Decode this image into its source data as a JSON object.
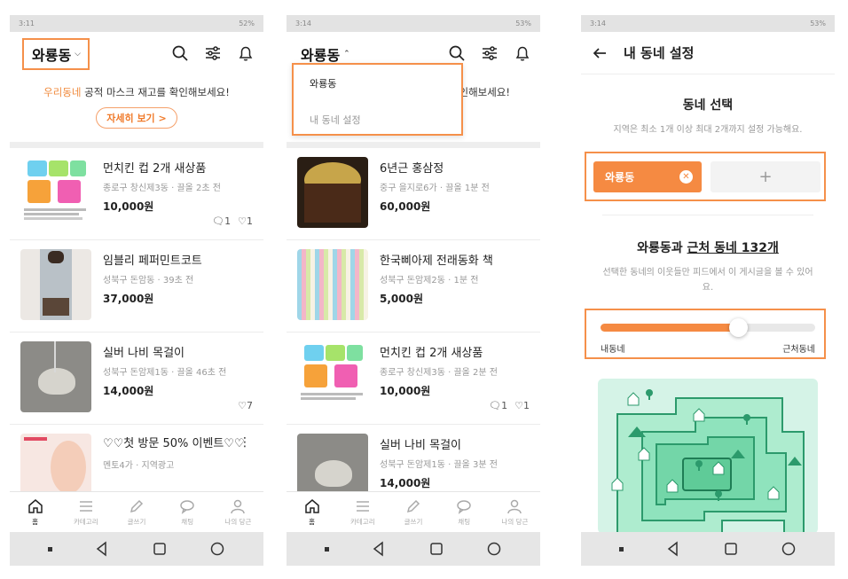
{
  "status": {
    "p1_time": "3:11",
    "p1_battery": "52%",
    "p2_time": "3:14",
    "p2_battery": "53%",
    "p3_time": "3:14",
    "p3_battery": "53%"
  },
  "home": {
    "location": "와룡동",
    "banner_highlight": "우리동네",
    "banner_text": " 공적 마스크 재고를 확인해보세요!",
    "banner_btn": "자세히 보기 >"
  },
  "phone1_items": [
    {
      "title": "먼치킨 컵 2개 새상품",
      "meta": "종로구 창신제3동 · 끌올 2초 전",
      "price": "10,000원",
      "chats": "1",
      "likes": "1"
    },
    {
      "title": "임블리 페퍼민트코트",
      "meta": "성북구 돈암동 · 39초 전",
      "price": "37,000원"
    },
    {
      "title": "실버 나비 목걸이",
      "meta": "성북구 돈암제1동 · 끌올 46초 전",
      "price": "14,000원",
      "likes": "7"
    },
    {
      "title": "♡♡첫 방문 50% 이벤트♡♡",
      "meta": "멘토4가 · 지역광고"
    }
  ],
  "dropdown": {
    "selected": "와룡동",
    "settings": "내 동네 설정",
    "banner_partial": "인해보세요!"
  },
  "phone2_items": [
    {
      "title": "6년근 홍삼정",
      "meta": "중구 을지로6가 · 끌올 1분 전",
      "price": "60,000원"
    },
    {
      "title": "한국삐아제 전래동화 책",
      "meta": "성북구 돈암제2동 · 1분 전",
      "price": "5,000원"
    },
    {
      "title": "먼치킨 컵 2개 새상품",
      "meta": "종로구 창신제3동 · 끌올 2분 전",
      "price": "10,000원",
      "chats": "1",
      "likes": "1"
    },
    {
      "title": "실버 나비 목걸이",
      "meta": "성북구 돈암제1동 · 끌올 3분 전",
      "price": "14,000원"
    }
  ],
  "nav": [
    "홈",
    "카테고리",
    "글쓰기",
    "채팅",
    "나의 당근"
  ],
  "settings": {
    "title": "내 동네 설정",
    "select_title": "동네 선택",
    "select_sub": "지역은 최소 1개 이상 최대 2개까지 설정 가능해요.",
    "chip": "와룡동",
    "chip_add": "+",
    "range_title_a": "와룡동과 ",
    "range_title_b": "근처 동네 132개",
    "range_sub": "선택한 동네의 이웃들만 피드에서 이 게시글을 볼 수 있어요.",
    "range_level": 0.64,
    "left_label": "내동네",
    "right_label": "근처동네"
  },
  "colors": {
    "accent": "#f58a42",
    "map_bg": "#d5f3e7",
    "map_dark": "#1a9b6a"
  }
}
